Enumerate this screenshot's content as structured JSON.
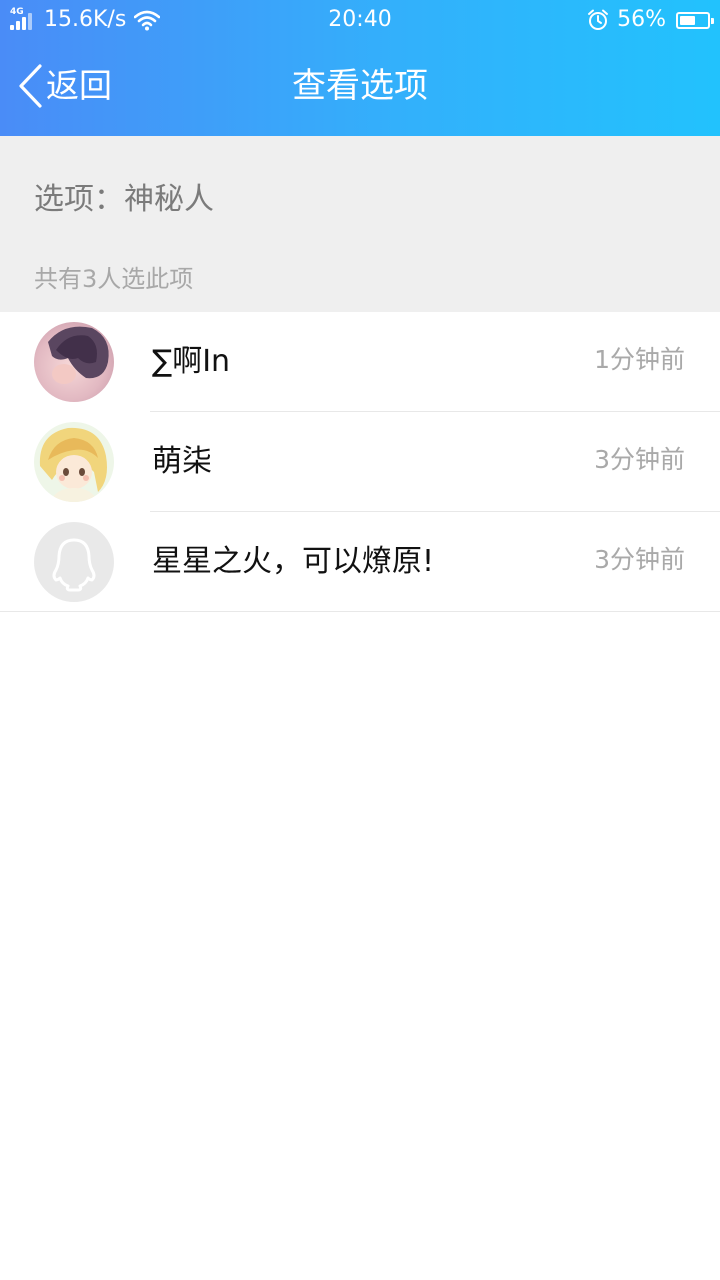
{
  "status_bar": {
    "network": "4G",
    "speed": "15.6K/s",
    "time": "20:40",
    "battery_percent": "56%",
    "battery_level": 0.56
  },
  "nav": {
    "back_label": "返回",
    "title": "查看选项"
  },
  "summary": {
    "option_text": "选项：神秘人",
    "count_text": "共有3人选此项"
  },
  "voters": [
    {
      "name": "∑啊In",
      "time": "1分钟前",
      "avatar": "photo-avatar-icon"
    },
    {
      "name": "萌柒",
      "time": "3分钟前",
      "avatar": "anime-avatar-icon"
    },
    {
      "name": "星星之火，可以燎原!",
      "time": "3分钟前",
      "avatar": "default-penguin-avatar-icon"
    }
  ],
  "colors": {
    "header_start": "#4a8cf7",
    "header_end": "#22c2fd",
    "summary_bg": "#efefef"
  }
}
